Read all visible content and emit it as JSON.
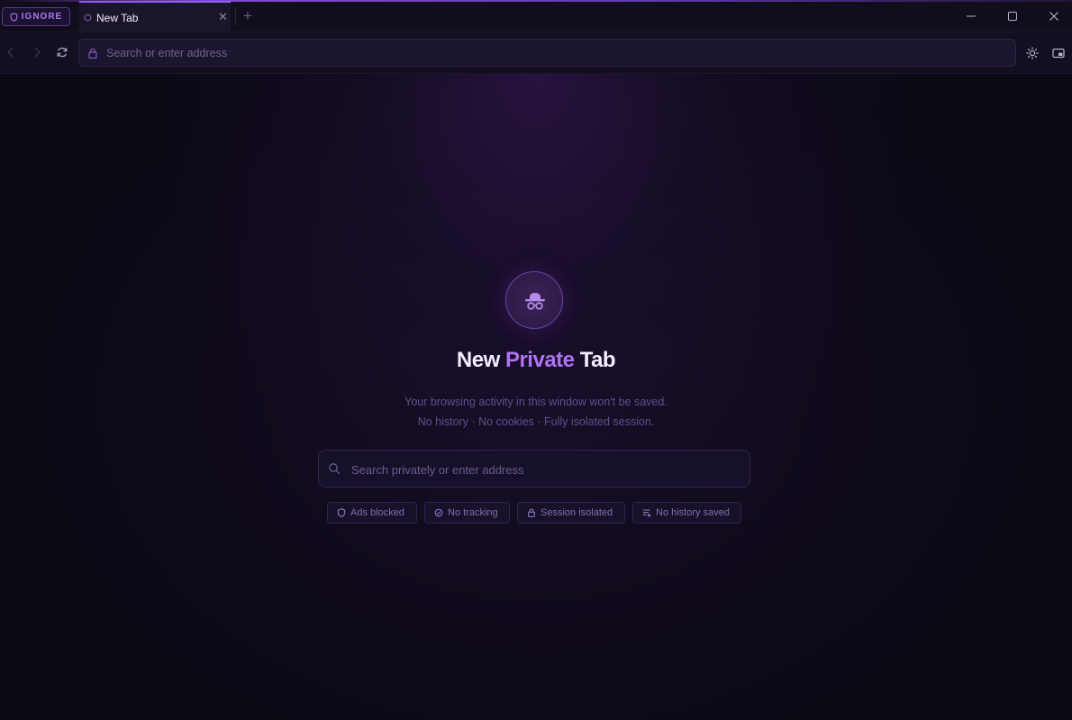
{
  "mode_badge": {
    "label": "IGNORE",
    "icon": "shield-icon"
  },
  "tabs": [
    {
      "title": "New Tab",
      "active": true
    }
  ],
  "toolbar": {
    "address_placeholder": "Search or enter address"
  },
  "hero": {
    "icon": "incognito-icon",
    "title_prefix": "New",
    "title_accent": "Private",
    "title_suffix": "Tab",
    "subtitle_line1": "Your browsing activity in this window won't be saved.",
    "subtitle_line2": "No history · No cookies · Fully isolated session."
  },
  "private_search": {
    "placeholder": "Search privately or enter address"
  },
  "features": [
    {
      "label": "Ads blocked",
      "icon": "shield-icon"
    },
    {
      "label": "No tracking",
      "icon": "no-tracking-icon"
    },
    {
      "label": "Session isolated",
      "icon": "lock-icon"
    },
    {
      "label": "No history saved",
      "icon": "list-icon"
    }
  ],
  "colors": {
    "accent": "#b073f0",
    "background": "#0c0915",
    "tab_highlight": "#8f5cf0"
  }
}
